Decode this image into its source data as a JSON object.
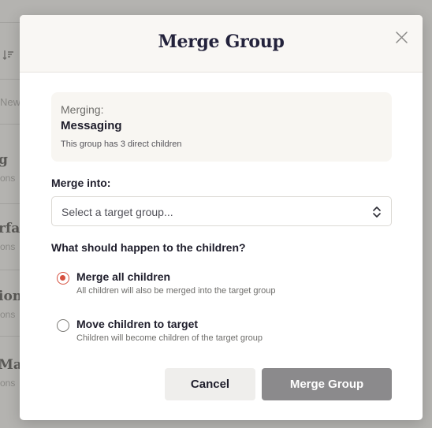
{
  "background": {
    "newest_label": "New",
    "rows": [
      {
        "title": "g",
        "subtitle": "ons"
      },
      {
        "title": "rfac",
        "subtitle": "ons"
      },
      {
        "title": "ion",
        "subtitle": "ons"
      },
      {
        "title": "Ma",
        "subtitle": "ons"
      }
    ]
  },
  "modal": {
    "title": "Merge Group",
    "close_icon": "close-icon",
    "info": {
      "label": "Merging:",
      "name": "Messaging",
      "description": "This group has 3 direct children"
    },
    "merge_into": {
      "label": "Merge into:",
      "placeholder": "Select a target group...",
      "icon": "chevron-up-down-icon"
    },
    "children_question": "What should happen to the children?",
    "options": [
      {
        "title": "Merge all children",
        "description": "All children will also be merged into the target group",
        "checked": true
      },
      {
        "title": "Move children to target",
        "description": "Children will become children of the target group",
        "checked": false
      }
    ],
    "buttons": {
      "cancel": "Cancel",
      "merge": "Merge Group"
    }
  },
  "colors": {
    "accent_radio": "#d6503f",
    "merge_button_disabled": "#8b8a8c",
    "title_text": "#23223b"
  }
}
